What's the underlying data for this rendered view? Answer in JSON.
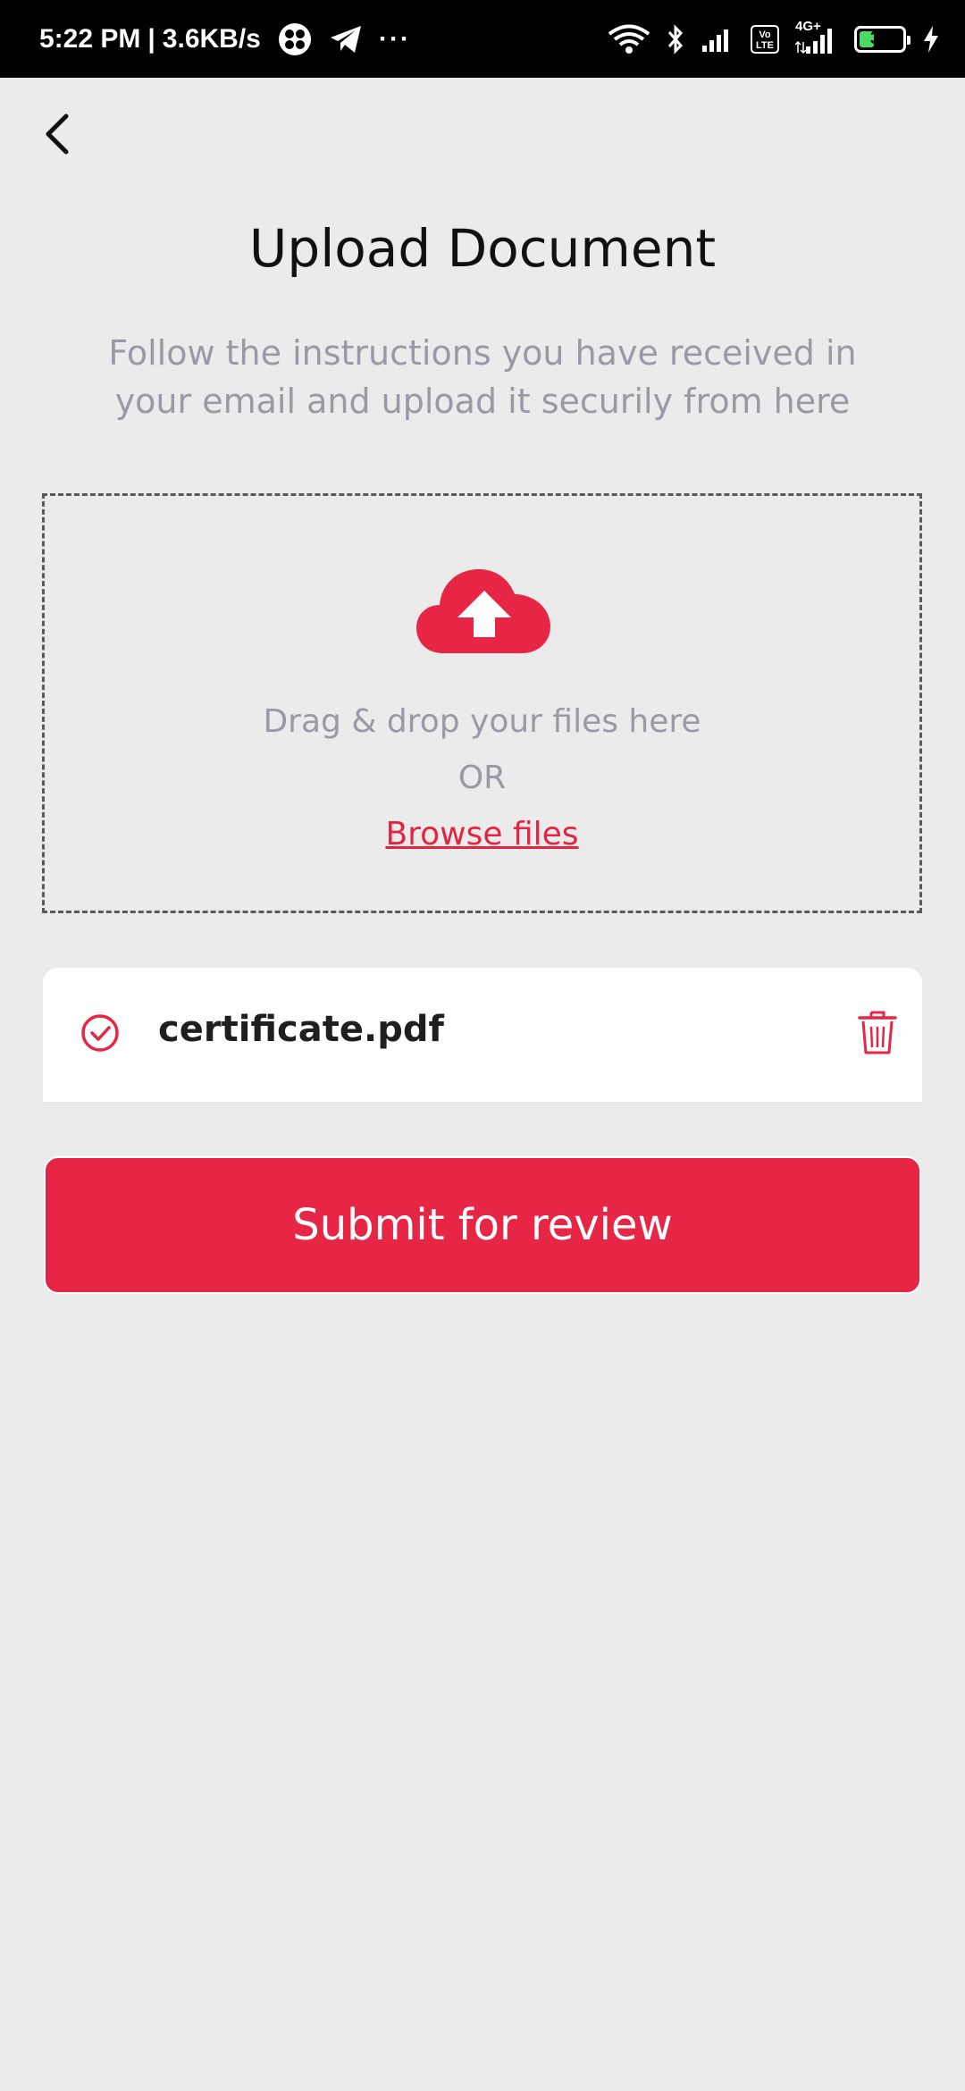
{
  "status_bar": {
    "time": "5:22 PM",
    "separator": "|",
    "network_speed": "3.6KB/s",
    "more": "···",
    "lte_label": "Vo LTE",
    "network_type": "4G+",
    "battery_level": "34",
    "battery_fraction": 0.34,
    "battery_color": "#4cd964"
  },
  "header": {
    "back_icon": "chevron-left-icon",
    "title": "Upload Document",
    "subtitle": "Follow the instructions you have received in your email and upload it securily from here"
  },
  "drop_zone": {
    "icon": "cloud-upload-icon",
    "drag_text": "Drag & drop your files here",
    "or_text": "OR",
    "browse_label": "Browse files"
  },
  "uploaded_file": {
    "status_icon": "check-circle-icon",
    "name": "certificate.pdf",
    "delete_icon": "trash-icon"
  },
  "actions": {
    "submit_label": "Submit for review"
  },
  "colors": {
    "accent": "#e62644",
    "background": "#ebebeb",
    "muted_text": "#9a9aa6"
  }
}
